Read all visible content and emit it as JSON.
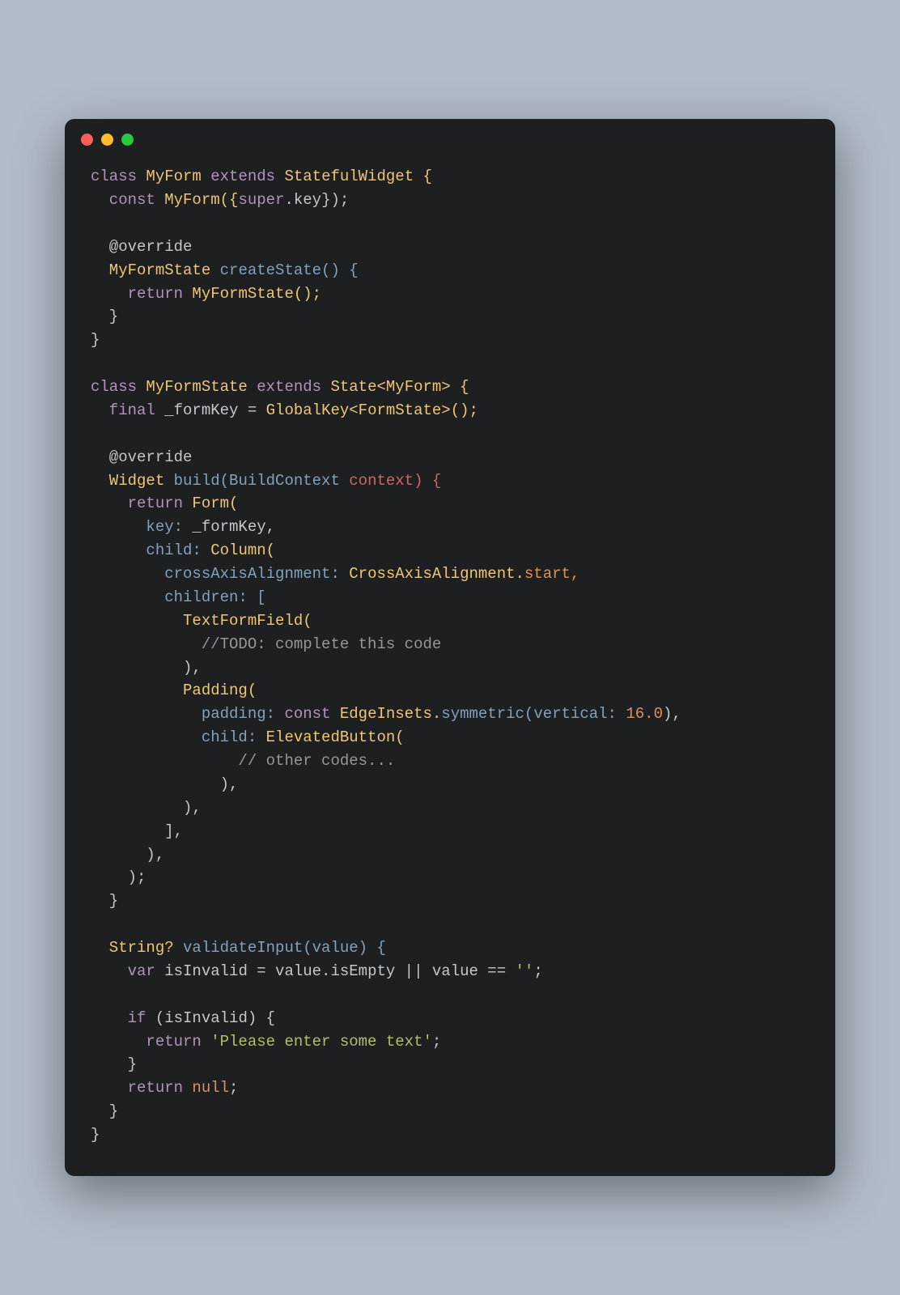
{
  "code": {
    "t1": "class",
    "t2": " MyForm ",
    "t3": "extends",
    "t4": " StatefulWidget {",
    "t5": "  const",
    "t6": " MyForm({",
    "t7": "super",
    "t8": ".key});",
    "t9": "  @override",
    "t10": "  MyFormState ",
    "t11": "createState() {",
    "t12": "    return",
    "t13": " MyFormState();",
    "t14": "  }",
    "t15": "}",
    "t16": "class",
    "t17": " MyFormState ",
    "t18": "extends",
    "t19": " State<MyForm> {",
    "t20": "  final",
    "t21": " _formKey = ",
    "t22": "GlobalKey<FormState>();",
    "t23": "  @override",
    "t24": "  Widget ",
    "t25": "build(BuildContext ",
    "t26": "context) {",
    "t27": "    return",
    "t28": " Form(",
    "t29": "      key: ",
    "t30": "_formKey,",
    "t31": "      child: ",
    "t32": "Column(",
    "t33": "        crossAxisAlignment: ",
    "t34": "CrossAxisAlignment.",
    "t35": "start,",
    "t36": "        children: [",
    "t37": "          TextFormField(",
    "t38": "            //TODO: complete this code",
    "t39": "          ),",
    "t40": "          Padding(",
    "t41": "            padding: ",
    "t42": "const",
    "t43": " EdgeInsets.",
    "t44": "symmetric(",
    "t45": "vertical: ",
    "t46": "16.0",
    "t47": "),",
    "t48": "            child: ",
    "t49": "ElevatedButton(",
    "t50": "                // other codes...",
    "t51": "              ),",
    "t52": "          ),",
    "t53": "        ],",
    "t54": "      ),",
    "t55": "    );",
    "t56": "  }",
    "t57": "  String? ",
    "t58": "validateInput(value) {",
    "t59": "    var",
    "t60": " isInvalid = value.isEmpty || value == ",
    "t61": "''",
    "t62": ";",
    "t63": "    if",
    "t64": " (isInvalid) {",
    "t65": "      return",
    "t66": " 'Please enter some text'",
    "t67": ";",
    "t68": "    }",
    "t69": "    return",
    "t70": " null",
    "t71": ";",
    "t72": "  }",
    "t73": "}"
  }
}
